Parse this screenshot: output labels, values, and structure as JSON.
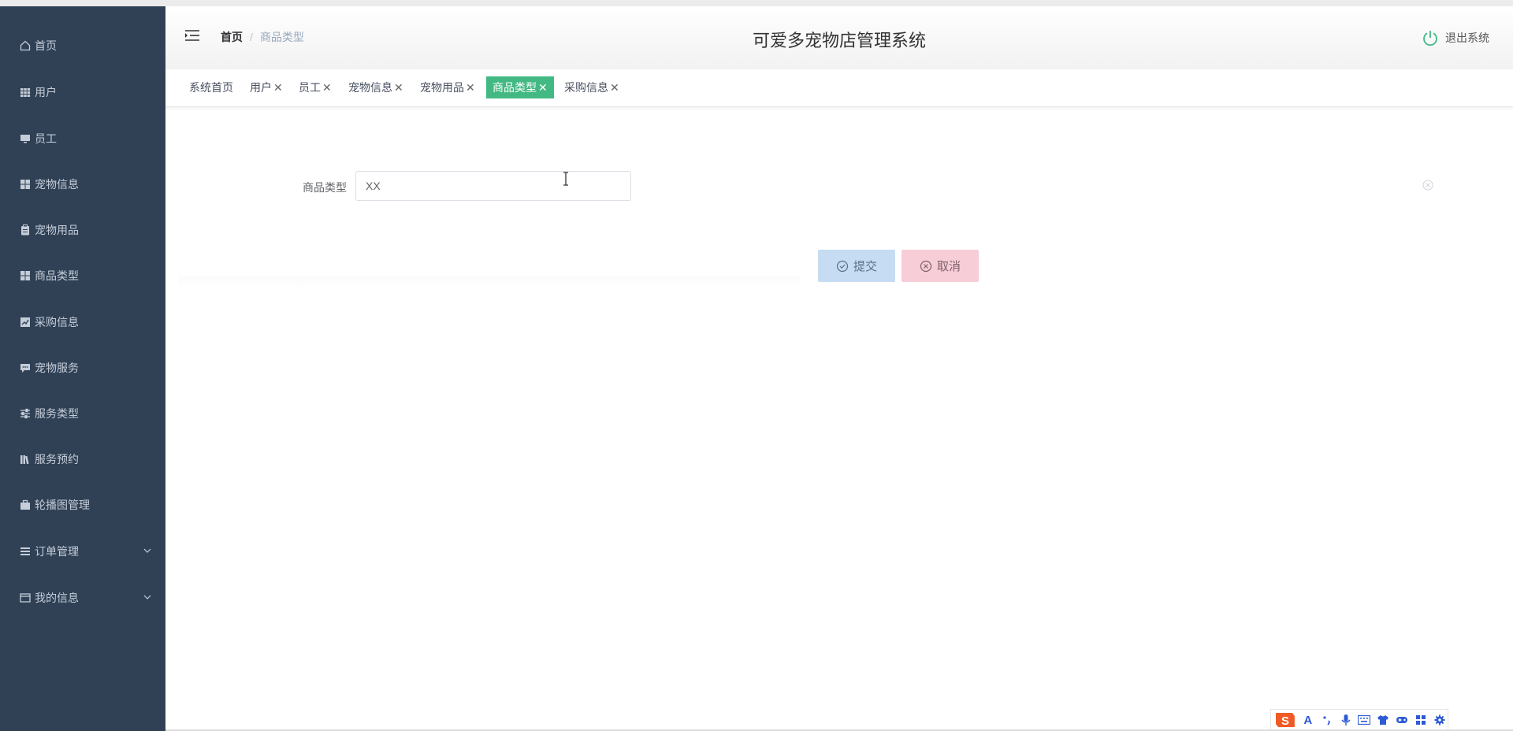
{
  "app": {
    "title": "可爱多宠物店管理系统",
    "logout_label": "退出系统"
  },
  "sidebar": {
    "items": [
      {
        "label": "首页",
        "icon": "home-icon"
      },
      {
        "label": "用户",
        "icon": "grid-icon"
      },
      {
        "label": "员工",
        "icon": "monitor-icon"
      },
      {
        "label": "宠物信息",
        "icon": "dashboard-icon"
      },
      {
        "label": "宠物用品",
        "icon": "clipboard-icon"
      },
      {
        "label": "商品类型",
        "icon": "dashboard-icon"
      },
      {
        "label": "采购信息",
        "icon": "chart-icon"
      },
      {
        "label": "宠物服务",
        "icon": "message-icon"
      },
      {
        "label": "服务类型",
        "icon": "sliders-icon"
      },
      {
        "label": "服务预约",
        "icon": "books-icon"
      },
      {
        "label": "轮播图管理",
        "icon": "briefcase-icon"
      },
      {
        "label": "订单管理",
        "icon": "list-icon"
      },
      {
        "label": "我的信息",
        "icon": "card-icon"
      }
    ]
  },
  "breadcrumb": {
    "home": "首页",
    "separator": "/",
    "current": "商品类型"
  },
  "tabs": [
    {
      "label": "系统首页",
      "closable": false
    },
    {
      "label": "用户",
      "closable": true
    },
    {
      "label": "员工",
      "closable": true
    },
    {
      "label": "宠物信息",
      "closable": true
    },
    {
      "label": "宠物用品",
      "closable": true
    },
    {
      "label": "商品类型",
      "closable": true,
      "active": true
    },
    {
      "label": "采购信息",
      "closable": true
    }
  ],
  "tab_close_glyph": "✕",
  "form": {
    "field_label": "商品类型",
    "field_value": "XX",
    "submit_label": "提交",
    "cancel_label": "取消"
  },
  "colors": {
    "sidebar_bg": "#304156",
    "active_tab": "#42b983",
    "submit_bg": "#c6dcf2",
    "cancel_bg": "#f7cdd8"
  },
  "ime_toolbar": {
    "icons": [
      "sogou-logo-icon",
      "font-icon",
      "punctuation-icon",
      "microphone-icon",
      "keyboard-icon",
      "skin-icon",
      "gamepad-icon",
      "apps-icon",
      "settings-icon"
    ],
    "font_glyph": "A"
  }
}
